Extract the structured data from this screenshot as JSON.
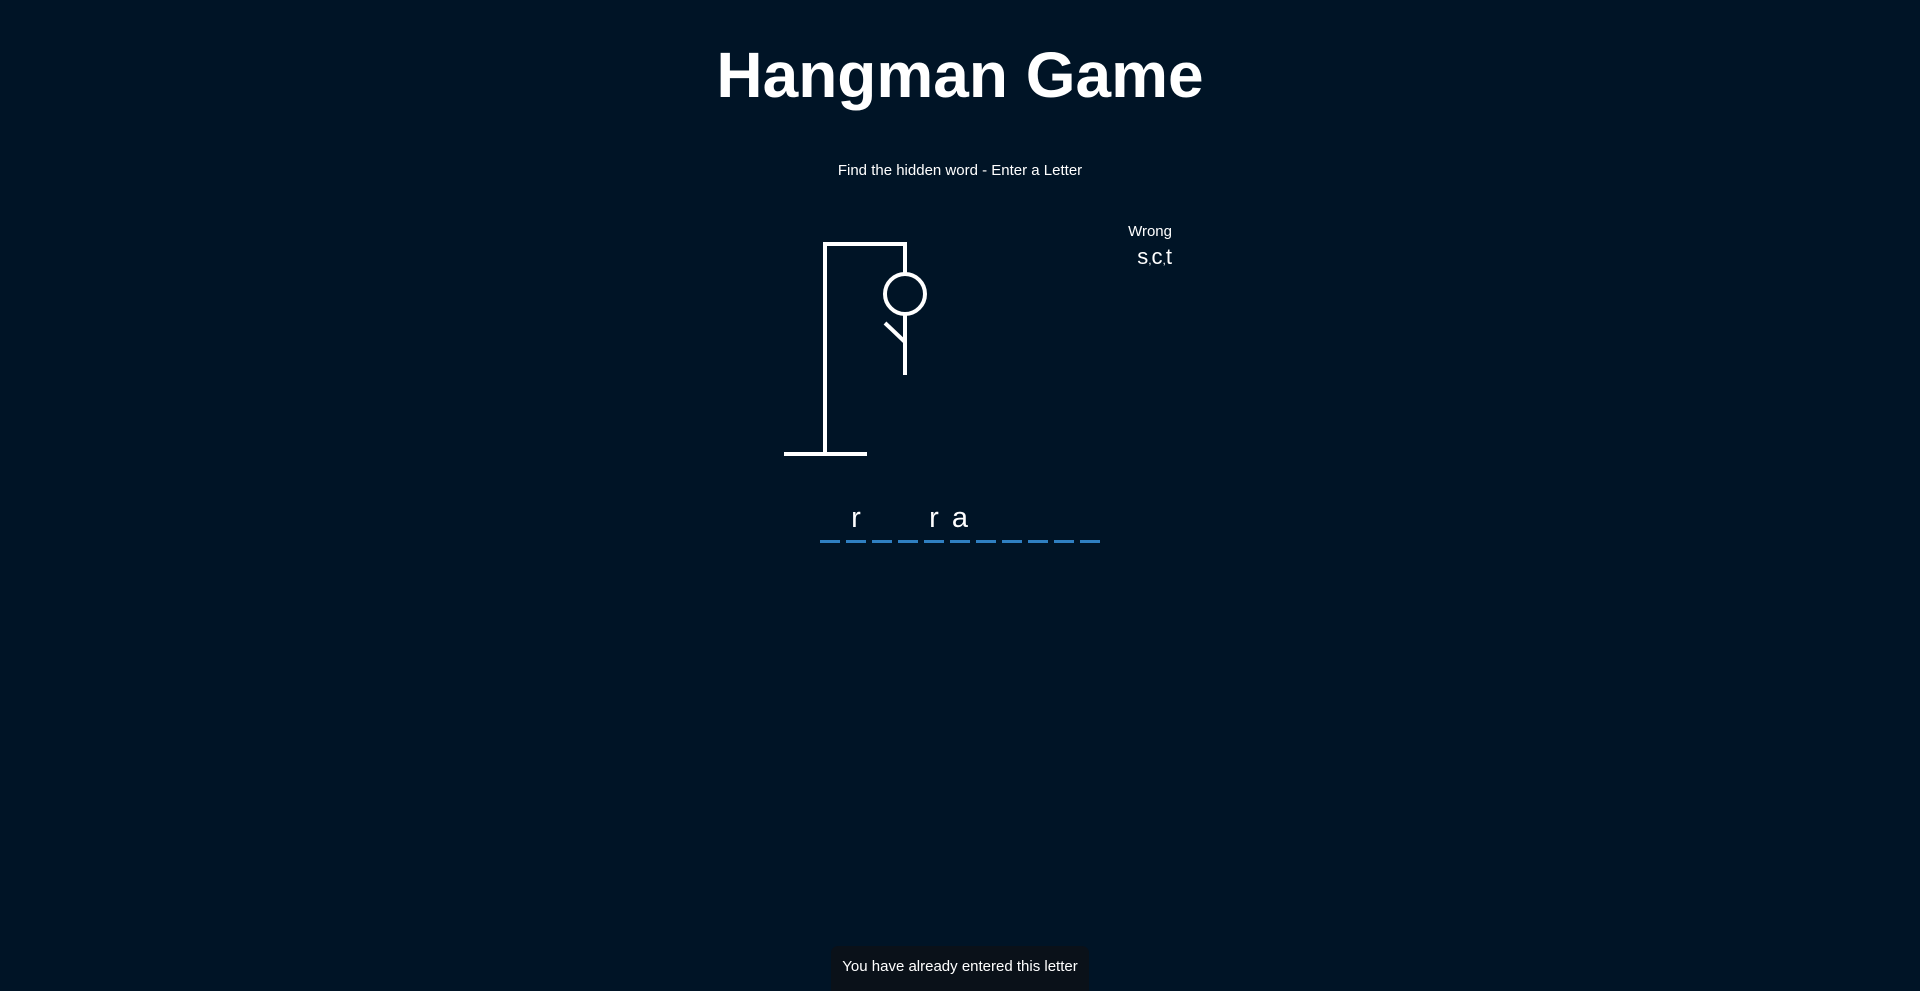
{
  "title": "Hangman Game",
  "subtitle": "Find the hidden word - Enter a Letter",
  "wrong": {
    "label": "Wrong",
    "letters": [
      "s",
      "c",
      "t"
    ],
    "separator": ","
  },
  "word": {
    "slots": [
      "",
      "r",
      "",
      "",
      "r",
      "a",
      "",
      "",
      "",
      "",
      ""
    ]
  },
  "notification": "You have already entered this letter",
  "figure": {
    "parts_shown": [
      "base",
      "pole",
      "beam",
      "rope",
      "head",
      "body",
      "left-arm"
    ]
  },
  "colors": {
    "background": "#001426",
    "text": "#ffffff",
    "slot_underline": "#2f7fc1",
    "toast_background": "#0a1119"
  }
}
